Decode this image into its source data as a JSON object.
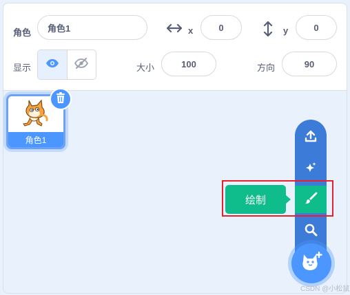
{
  "sprite_info": {
    "sprite_label": "角色",
    "sprite_name": "角色1",
    "x_label": "x",
    "x_value": "0",
    "y_label": "y",
    "y_value": "0",
    "show_label": "显示",
    "size_label": "大小",
    "size_value": "100",
    "direction_label": "方向",
    "direction_value": "90"
  },
  "sprites": [
    {
      "name": "角色1",
      "selected": true
    }
  ],
  "sprite_menu": {
    "items": [
      "upload-icon",
      "surprise-icon",
      "paint-icon",
      "search-icon"
    ],
    "tooltip": "绘制",
    "main_button": "add-sprite-icon"
  },
  "watermark": "CSDN @小松鼠",
  "colors": {
    "accent": "#4c97ff",
    "menu_blue": "#3c7bd7",
    "paint_green": "#0fbd8c",
    "highlight_red": "#e8202a",
    "cat_orange": "#f7a23c"
  }
}
